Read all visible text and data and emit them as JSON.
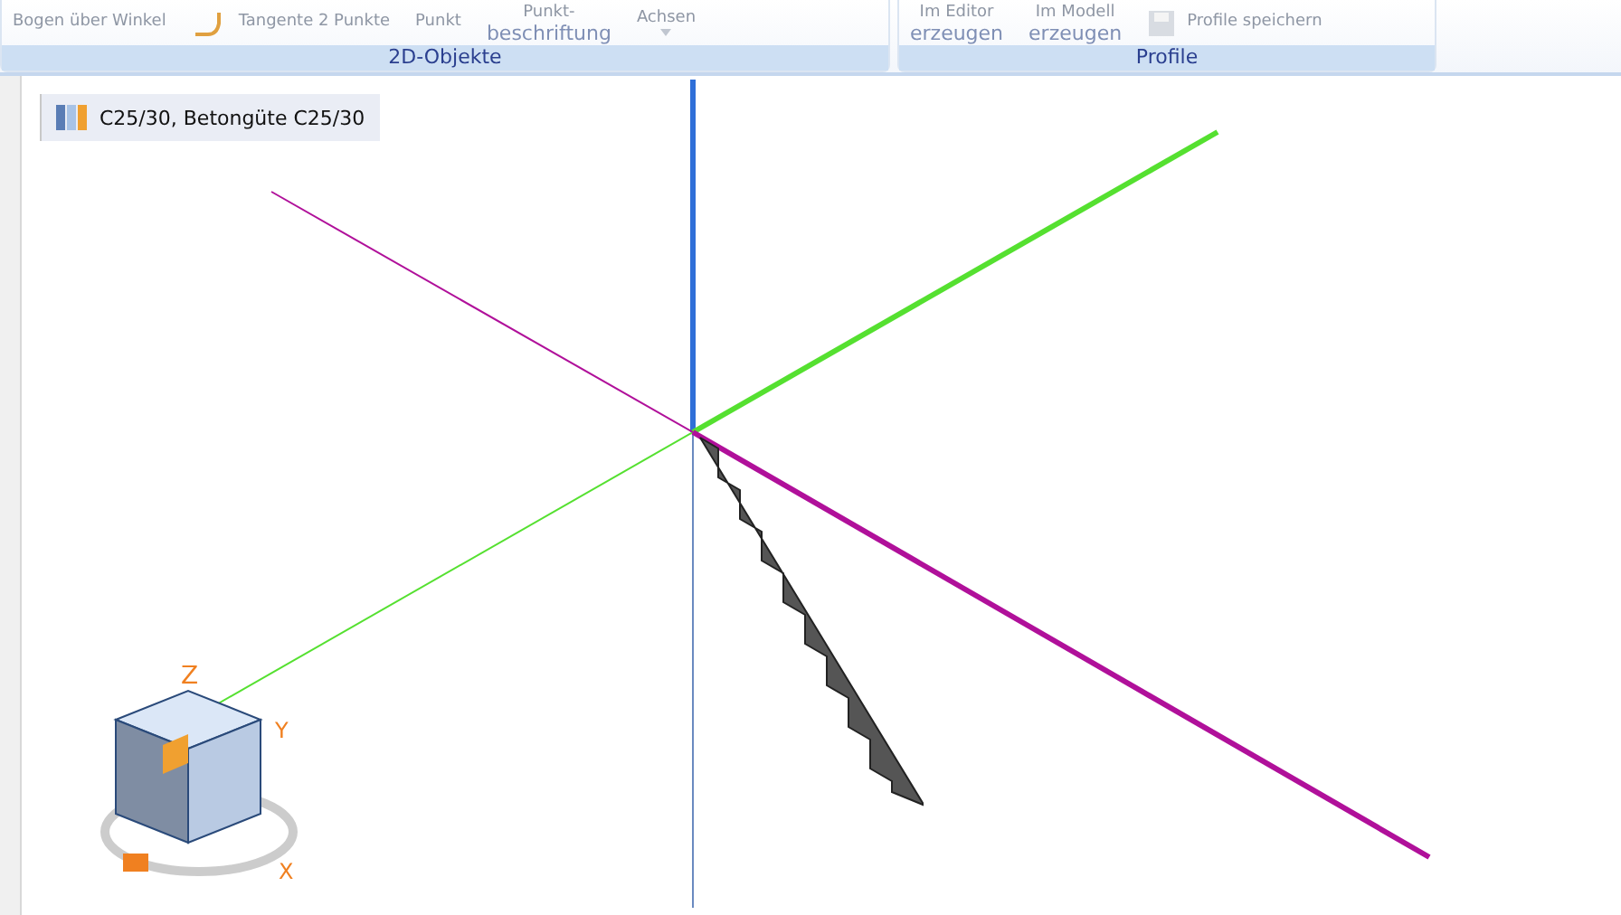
{
  "ribbon": {
    "groups": [
      {
        "label": "2D-Objekte",
        "items": [
          {
            "kind": "text",
            "lines": [
              "Bogen über Winkel"
            ]
          },
          {
            "kind": "tangent",
            "lines": [
              "Tangente 2 Punkte"
            ]
          },
          {
            "kind": "text",
            "lines": [
              "Punkt"
            ]
          },
          {
            "kind": "text",
            "lines": [
              "Punkt-",
              "beschriftung"
            ]
          },
          {
            "kind": "dropdown",
            "lines": [
              "Achsen"
            ]
          }
        ]
      },
      {
        "label": "Profile",
        "items": [
          {
            "kind": "text",
            "lines": [
              "Im Editor",
              "erzeugen"
            ]
          },
          {
            "kind": "text",
            "lines": [
              "Im Modell",
              "erzeugen"
            ]
          },
          {
            "kind": "save",
            "lines": [
              "Profile speichern"
            ]
          }
        ]
      }
    ]
  },
  "material": {
    "label": "C25/30, Betongüte C25/30"
  },
  "view_cube": {
    "axes": [
      "Z",
      "Y",
      "X"
    ]
  }
}
